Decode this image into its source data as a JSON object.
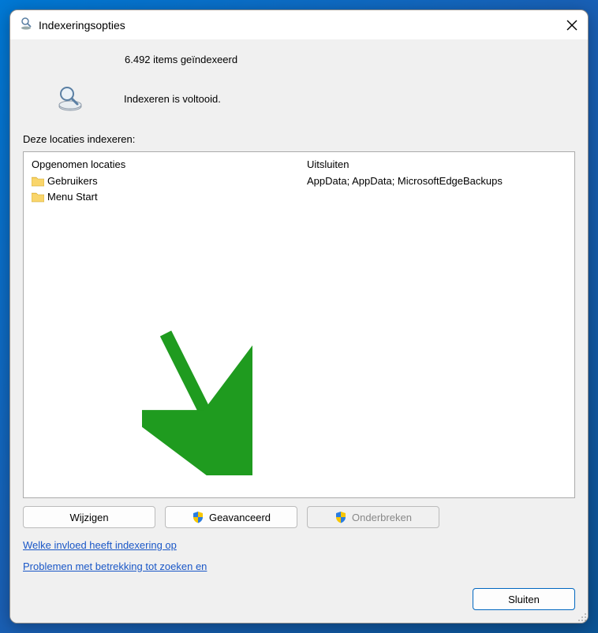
{
  "titlebar": {
    "title": "Indexeringsopties"
  },
  "status": {
    "count_line": "6.492 items geïndexeerd",
    "completion": "Indexeren is voltooid."
  },
  "section_label": "Deze locaties indexeren:",
  "columns": {
    "included": "Opgenomen locaties",
    "excluded": "Uitsluiten"
  },
  "rows": [
    {
      "name": "Gebruikers",
      "exclude": "AppData; AppData; MicrosoftEdgeBackups"
    },
    {
      "name": "Menu Start",
      "exclude": ""
    }
  ],
  "buttons": {
    "modify": "Wijzigen",
    "advanced": "Geavanceerd",
    "pause": "Onderbreken",
    "close": "Sluiten"
  },
  "links": {
    "howaffects": "Welke invloed heeft indexering op",
    "troubleshoot": "Problemen met betrekking tot zoeken en"
  }
}
